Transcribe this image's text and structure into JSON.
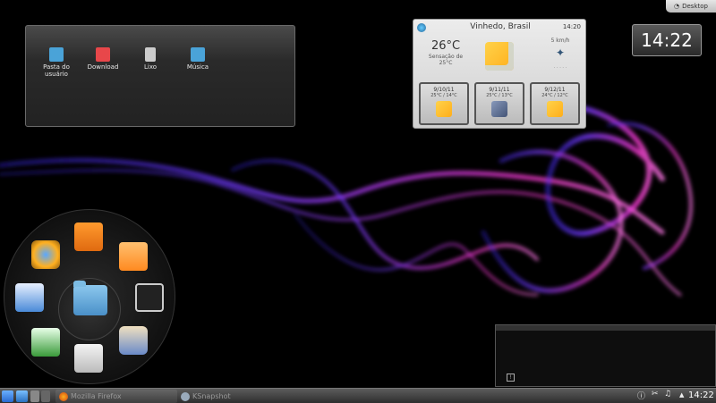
{
  "desktop_button": {
    "label": "Desktop"
  },
  "folder_view": {
    "items": [
      {
        "label": "Pasta do usuário",
        "icon": "home-folder-icon",
        "color": "#4aa3d8"
      },
      {
        "label": "Download",
        "icon": "download-folder-icon",
        "color": "#e8474a"
      },
      {
        "label": "Lixo",
        "icon": "trash-icon",
        "color": "#cccccc"
      },
      {
        "label": "Música",
        "icon": "music-folder-icon",
        "color": "#4aa3d8"
      }
    ]
  },
  "weather": {
    "city": "Vinhedo, Brasil",
    "time": "14:20",
    "temperature": "26°C",
    "feels_like_label": "Sensação de",
    "feels_like_value": "25°C",
    "wind": "5 km/h",
    "forecast": [
      {
        "date": "9/10/11",
        "range": "25°C / 14°C",
        "icon": "sunny-cloud-icon"
      },
      {
        "date": "9/11/11",
        "range": "25°C / 13°C",
        "icon": "storm-icon"
      },
      {
        "date": "9/12/11",
        "range": "24°C / 12°C",
        "icon": "sunny-cloud-icon"
      }
    ]
  },
  "clock": {
    "time": "14:22"
  },
  "taskbar": {
    "tasks": [
      {
        "label": "Mozilla Firefox",
        "icon": "firefox-icon"
      },
      {
        "label": "KSnapshot",
        "icon": "ksnapshot-icon"
      }
    ],
    "clock": "14:22"
  },
  "colors": {
    "panel": "#3a3a3a",
    "smoke_purple": "#8a3cff",
    "smoke_pink": "#ff2fd0"
  }
}
